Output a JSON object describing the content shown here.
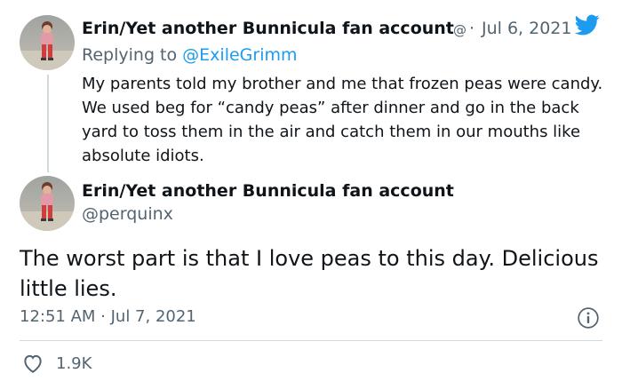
{
  "parent_tweet": {
    "display_name": "Erin/Yet another Bunnicula fan account",
    "handle": "@",
    "sep": "·",
    "date": "Jul 6, 2021",
    "reply_prefix": "Replying to",
    "reply_to": "@ExileGrimm",
    "text": "My parents told my brother and me that frozen peas were candy. We used beg for “candy peas” after dinner and go in the back yard to toss them in the air and catch them in our mouths like absolute idiots."
  },
  "main_tweet": {
    "display_name": "Erin/Yet another Bunnicula fan account",
    "handle": "@perquinx",
    "text": "The worst part is that I love peas to this day. Delicious little lies.",
    "time": "12:51 AM · Jul 7, 2021",
    "likes": "1.9K"
  },
  "colors": {
    "accent": "#1d9bf0",
    "text": "#0f1419",
    "muted": "#536471",
    "like": "#536471",
    "divider": "#cfd9de"
  },
  "icons": {
    "brand": "twitter-bird-icon",
    "info": "info-icon",
    "like": "heart-icon",
    "verified": "none"
  }
}
